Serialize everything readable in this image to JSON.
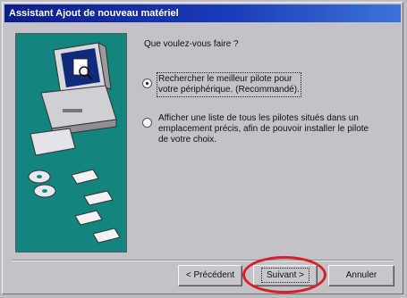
{
  "window": {
    "title": "Assistant Ajout de nouveau matériel"
  },
  "wizard": {
    "question": "Que voulez-vous faire ?",
    "options": [
      {
        "label": "Rechercher le meilleur pilote pour votre périphérique. (Recommandé).",
        "selected": true
      },
      {
        "label": "Afficher une liste de tous les pilotes situés dans un emplacement précis, afin de pouvoir installer le pilote de votre choix.",
        "selected": false
      }
    ]
  },
  "buttons": {
    "back": "< Précédent",
    "next": "Suivant >",
    "cancel": "Annuler"
  },
  "icons": {
    "illustration": "computer-with-disks-illustration"
  },
  "colors": {
    "titlebar": "#0b1d8a",
    "illustration_bg": "#12857e",
    "highlight_ring": "#d61f27"
  }
}
